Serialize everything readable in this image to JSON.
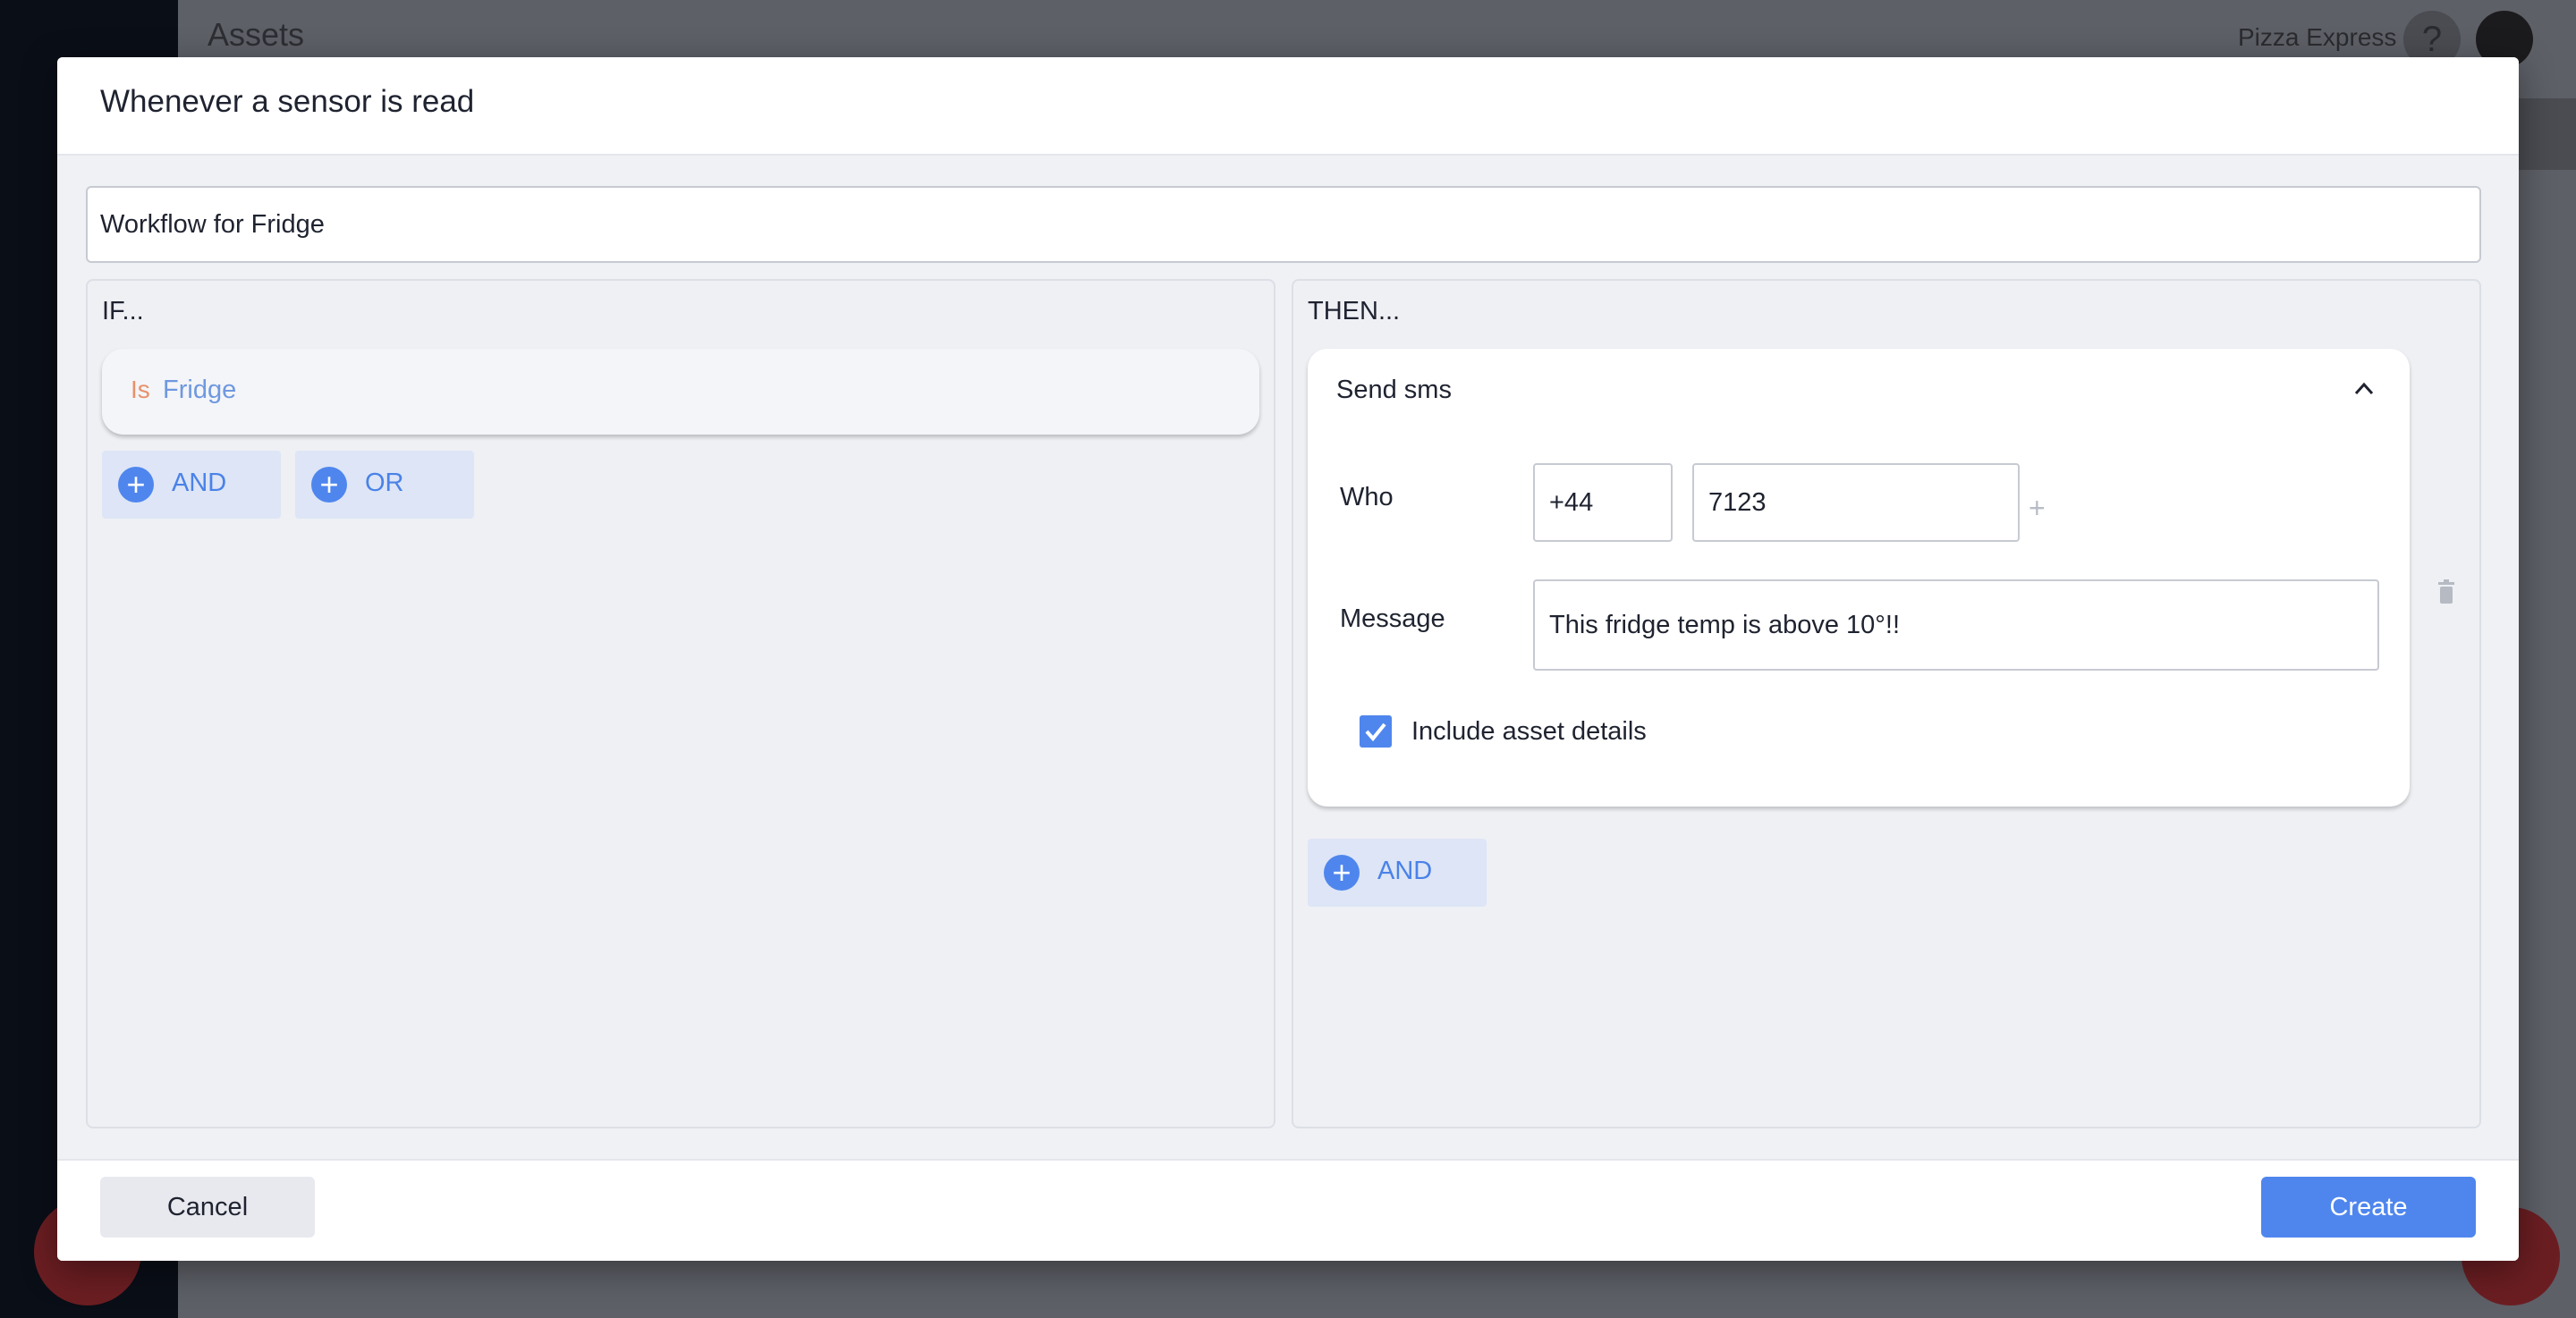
{
  "background": {
    "page_title": "Assets",
    "brand_name": "Pizza Express",
    "help_icon": "question-icon"
  },
  "modal": {
    "title": "Whenever a sensor is read",
    "workflow_name": "Workflow for Fridge",
    "if_section": {
      "label": "IF...",
      "conditions": [
        {
          "operator": "Is",
          "value": "Fridge"
        }
      ],
      "and_label": "AND",
      "or_label": "OR"
    },
    "then_section": {
      "label": "THEN...",
      "action": {
        "title": "Send sms",
        "who_label": "Who",
        "country_code": "+44",
        "phone_number": "7123",
        "add_phone_icon": "plus-icon",
        "message_label": "Message",
        "message_value": "This fridge temp is above 10°!!",
        "include_asset_details_label": "Include asset details",
        "include_asset_details_checked": true
      },
      "and_label": "AND"
    },
    "footer": {
      "cancel_label": "Cancel",
      "create_label": "Create"
    }
  },
  "colors": {
    "accent": "#4f86ee",
    "operator": "#e8916a",
    "condition_value": "#6f98e0"
  }
}
